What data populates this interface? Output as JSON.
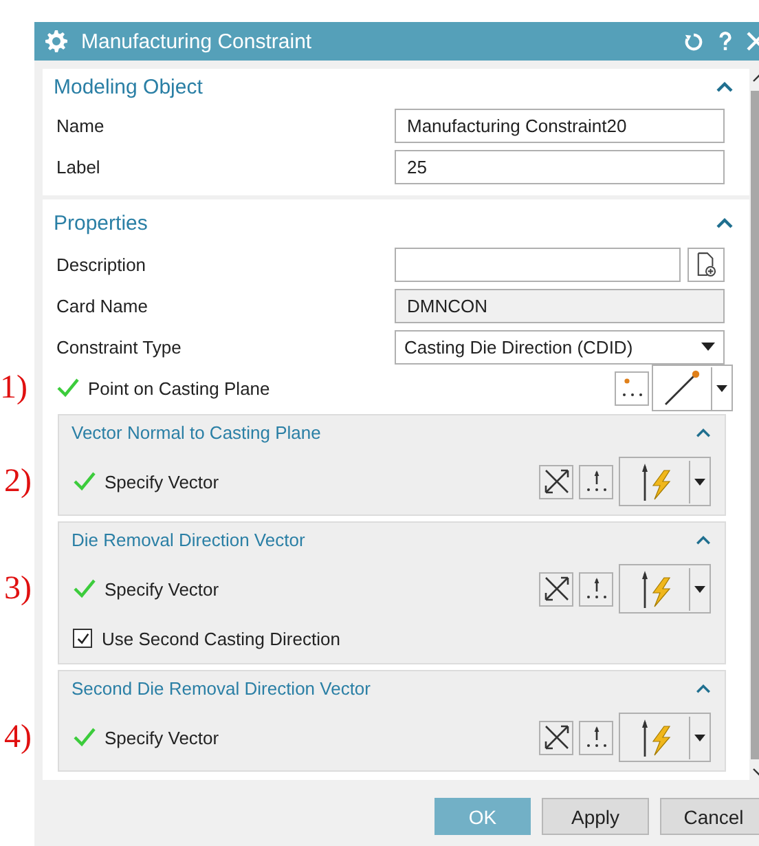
{
  "window": {
    "title": "Manufacturing Constraint"
  },
  "sections": [
    {
      "title": "Modeling Object",
      "expanded": true,
      "rows": [
        {
          "kind": "text",
          "label": "Name",
          "value": "Manufacturing Constraint20"
        },
        {
          "kind": "text",
          "label": "Label",
          "value": "25"
        }
      ]
    },
    {
      "title": "Properties",
      "expanded": true,
      "rows": [
        {
          "kind": "file",
          "label": "Description"
        },
        {
          "kind": "readonly",
          "label": "Card Name",
          "value": "DMNCON"
        },
        {
          "kind": "dropdown",
          "label": "Constraint Type",
          "value": "Casting Die Direction (CDID)"
        },
        {
          "kind": "point",
          "label": "Point on Casting Plane",
          "done": true,
          "annotation": "1)"
        }
      ],
      "groups": [
        {
          "title": "Vector Normal to Casting Plane",
          "expanded": true,
          "rows": [
            {
              "kind": "vector",
              "label": "Specify Vector",
              "done": true,
              "annotation": "2)"
            }
          ]
        },
        {
          "title": "Die Removal Direction Vector",
          "expanded": true,
          "rows": [
            {
              "kind": "vector",
              "label": "Specify Vector",
              "done": true,
              "annotation": "3)"
            },
            {
              "kind": "checkbox",
              "label": "Use Second Casting Direction",
              "checked": true
            }
          ]
        },
        {
          "title": "Second Die Removal Direction Vector",
          "expanded": true,
          "rows": [
            {
              "kind": "vector",
              "label": "Specify Vector",
              "done": true,
              "annotation": "4)"
            }
          ]
        }
      ]
    }
  ],
  "buttons": [
    {
      "label": "OK",
      "primary": true
    },
    {
      "label": "Apply",
      "primary": false
    },
    {
      "label": "Cancel",
      "primary": false
    }
  ]
}
